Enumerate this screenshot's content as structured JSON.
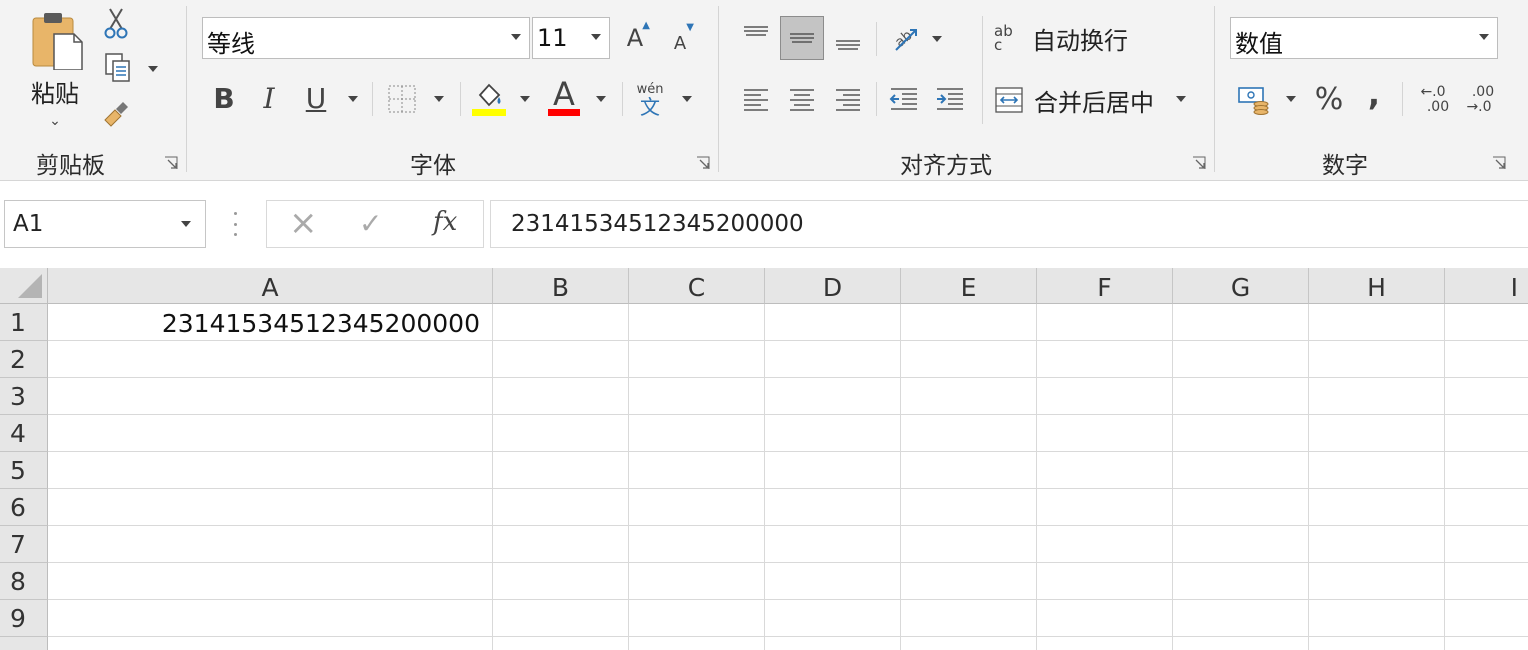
{
  "ribbon": {
    "clipboard": {
      "paste_label": "粘贴",
      "group_label": "剪贴板"
    },
    "font": {
      "font_name": "等线",
      "font_size": "11",
      "grow_label": "A",
      "shrink_label": "A",
      "bold_label": "B",
      "italic_label": "I",
      "underline_label": "U",
      "font_color_label": "A",
      "phonetic_top": "wén",
      "phonetic_bottom": "文",
      "group_label": "字体",
      "fill_color": "#ffff00",
      "font_color": "#ff0000"
    },
    "alignment": {
      "wrap_text_label": "自动换行",
      "merge_center_label": "合并后居中",
      "group_label": "对齐方式",
      "wrap_icon_top": "ab",
      "wrap_icon_bottom": "c"
    },
    "number": {
      "format": "数值",
      "percent_label": "%",
      "comma_label": ",",
      "inc_decimal_top": "←.0",
      "inc_decimal_bottom": ".00",
      "dec_decimal_top": ".00",
      "dec_decimal_bottom": "→.0",
      "group_label": "数字"
    }
  },
  "formula_bar": {
    "name_box": "A1",
    "cancel_icon": "×",
    "enter_icon": "✓",
    "fx_label": "fx",
    "formula": "23141534512345200000"
  },
  "grid": {
    "columns": [
      "A",
      "B",
      "C",
      "D",
      "E",
      "F",
      "G",
      "H",
      "I"
    ],
    "rows": [
      "1",
      "2",
      "3",
      "4",
      "5",
      "6",
      "7",
      "8",
      "9"
    ],
    "cells": {
      "A1": "23141534512345200000"
    }
  }
}
